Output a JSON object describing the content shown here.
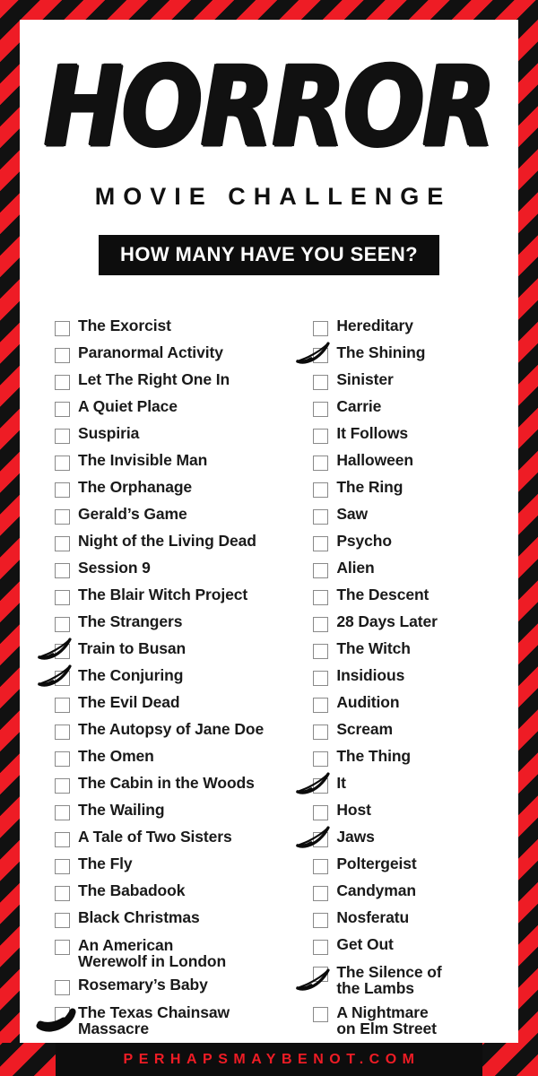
{
  "header": {
    "title": "HORROR",
    "subtitle": "MOVIE CHALLENGE",
    "banner": "HOW MANY HAVE YOU SEEN?"
  },
  "footer": {
    "site": "PERHAPSMAYBENOT.COM"
  },
  "colors": {
    "stripe_red": "#EE1C25",
    "stripe_black": "#111111",
    "banner_black": "#0D0D0D",
    "page_white": "#FFFFFF",
    "text_black": "#1A1A1A",
    "checkbox_border": "#8A8A8A",
    "footer_text_red": "#EE1C25"
  },
  "checklist": {
    "left_column": [
      {
        "label": "The Exorcist",
        "checked": false,
        "lines": 1
      },
      {
        "label": "Paranormal Activity",
        "checked": false,
        "lines": 1
      },
      {
        "label": "Let The Right One In",
        "checked": false,
        "lines": 1
      },
      {
        "label": "A Quiet Place",
        "checked": false,
        "lines": 1
      },
      {
        "label": "Suspiria",
        "checked": false,
        "lines": 1
      },
      {
        "label": "The Invisible Man",
        "checked": false,
        "lines": 1
      },
      {
        "label": "The Orphanage",
        "checked": false,
        "lines": 1
      },
      {
        "label": "Gerald’s Game",
        "checked": false,
        "lines": 1
      },
      {
        "label": "Night of the Living Dead",
        "checked": false,
        "lines": 1
      },
      {
        "label": "Session 9",
        "checked": false,
        "lines": 1
      },
      {
        "label": "The Blair Witch Project",
        "checked": false,
        "lines": 1
      },
      {
        "label": "The Strangers",
        "checked": false,
        "lines": 1
      },
      {
        "label": "Train to Busan",
        "checked": true,
        "lines": 1,
        "mark": "check"
      },
      {
        "label": "The Conjuring",
        "checked": true,
        "lines": 1,
        "mark": "check"
      },
      {
        "label": "The Evil Dead",
        "checked": false,
        "lines": 1
      },
      {
        "label": "The Autopsy of Jane Doe",
        "checked": false,
        "lines": 1
      },
      {
        "label": "The Omen",
        "checked": false,
        "lines": 1
      },
      {
        "label": "The Cabin in the Woods",
        "checked": false,
        "lines": 1
      },
      {
        "label": "The Wailing",
        "checked": false,
        "lines": 1
      },
      {
        "label": "A Tale of Two Sisters",
        "checked": false,
        "lines": 1
      },
      {
        "label": "The Fly",
        "checked": false,
        "lines": 1
      },
      {
        "label": "The Babadook",
        "checked": false,
        "lines": 1
      },
      {
        "label": "Black Christmas",
        "checked": false,
        "lines": 1
      },
      {
        "label": "An American\nWerewolf in London",
        "checked": false,
        "lines": 2
      },
      {
        "label": "Rosemary’s Baby",
        "checked": false,
        "lines": 1
      },
      {
        "label": "The Texas Chainsaw\nMassacre",
        "checked": true,
        "lines": 2,
        "mark": "scribble"
      }
    ],
    "right_column": [
      {
        "label": "Hereditary",
        "checked": false,
        "lines": 1
      },
      {
        "label": "The Shining",
        "checked": true,
        "lines": 1,
        "mark": "check"
      },
      {
        "label": "Sinister",
        "checked": false,
        "lines": 1
      },
      {
        "label": "Carrie",
        "checked": false,
        "lines": 1
      },
      {
        "label": "It Follows",
        "checked": false,
        "lines": 1
      },
      {
        "label": "Halloween",
        "checked": false,
        "lines": 1
      },
      {
        "label": "The Ring",
        "checked": false,
        "lines": 1
      },
      {
        "label": "Saw",
        "checked": false,
        "lines": 1
      },
      {
        "label": "Psycho",
        "checked": false,
        "lines": 1
      },
      {
        "label": "Alien",
        "checked": false,
        "lines": 1
      },
      {
        "label": "The Descent",
        "checked": false,
        "lines": 1
      },
      {
        "label": "28 Days Later",
        "checked": false,
        "lines": 1
      },
      {
        "label": "The Witch",
        "checked": false,
        "lines": 1
      },
      {
        "label": "Insidious",
        "checked": false,
        "lines": 1
      },
      {
        "label": "Audition",
        "checked": false,
        "lines": 1
      },
      {
        "label": "Scream",
        "checked": false,
        "lines": 1
      },
      {
        "label": "The Thing",
        "checked": false,
        "lines": 1
      },
      {
        "label": "It",
        "checked": true,
        "lines": 1,
        "mark": "check"
      },
      {
        "label": "Host",
        "checked": false,
        "lines": 1
      },
      {
        "label": "Jaws",
        "checked": true,
        "lines": 1,
        "mark": "check"
      },
      {
        "label": "Poltergeist",
        "checked": false,
        "lines": 1
      },
      {
        "label": "Candyman",
        "checked": false,
        "lines": 1
      },
      {
        "label": "Nosferatu",
        "checked": false,
        "lines": 1
      },
      {
        "label": "Get Out",
        "checked": false,
        "lines": 1
      },
      {
        "label": "The Silence of\nthe Lambs",
        "checked": true,
        "lines": 2,
        "mark": "check"
      },
      {
        "label": "A Nightmare\non Elm Street",
        "checked": false,
        "lines": 2
      }
    ]
  }
}
